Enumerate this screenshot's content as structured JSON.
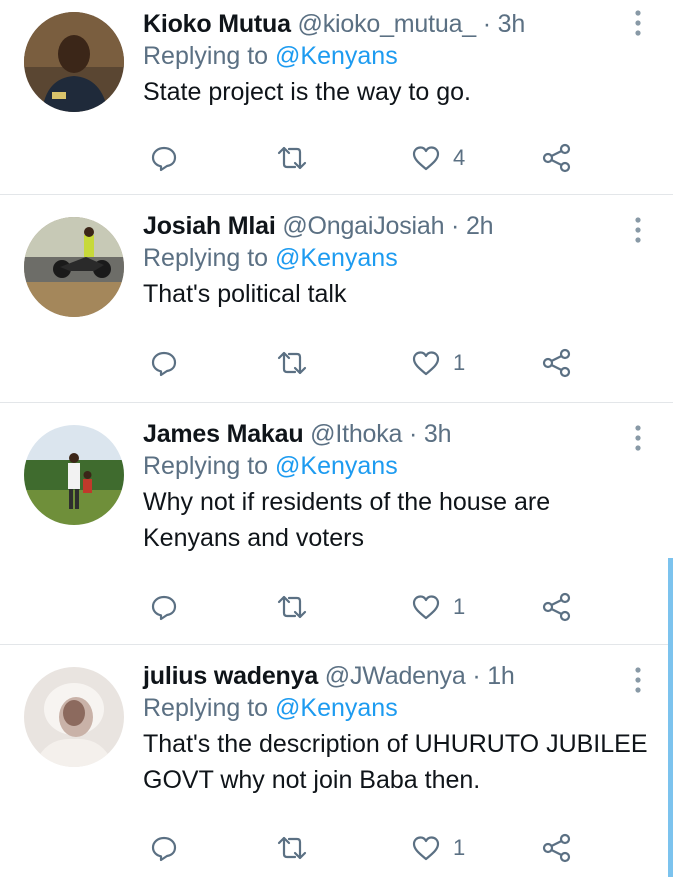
{
  "tweets": [
    {
      "author": "Kioko Mutua",
      "handle": "@kioko_mutua_",
      "separator": "·",
      "time": "3h",
      "replying_prefix": "Replying to ",
      "replying_to": "@Kenyans",
      "text": "State project is the way to go.",
      "likes": "4"
    },
    {
      "author": "Josiah Mlai",
      "handle": "@OngaiJosiah",
      "separator": "·",
      "time": "2h",
      "replying_prefix": "Replying to ",
      "replying_to": "@Kenyans",
      "text": "That's political talk",
      "likes": "1"
    },
    {
      "author": "James Makau",
      "handle": "@Ithoka",
      "separator": "·",
      "time": "3h",
      "replying_prefix": "Replying to ",
      "replying_to": "@Kenyans",
      "text": "Why not if residents of the house are Kenyans and voters",
      "likes": "1"
    },
    {
      "author": "julius wadenya",
      "handle": "@JWadenya",
      "separator": "·",
      "time": "1h",
      "replying_prefix": "Replying to ",
      "replying_to": "@Kenyans",
      "text": "That's the description of UHURUTO JUBILEE GOVT why not join Baba then.",
      "likes": "1"
    }
  ],
  "icons": {
    "reply": "reply-icon",
    "retweet": "retweet-icon",
    "like": "heart-icon",
    "share": "share-icon",
    "more": "more-vertical-icon"
  },
  "colors": {
    "text": "#0f1419",
    "secondary": "#5b7083",
    "link": "#1d9bf0",
    "divider": "#e3e6e9",
    "scrollbar": "#7cc3ee"
  }
}
